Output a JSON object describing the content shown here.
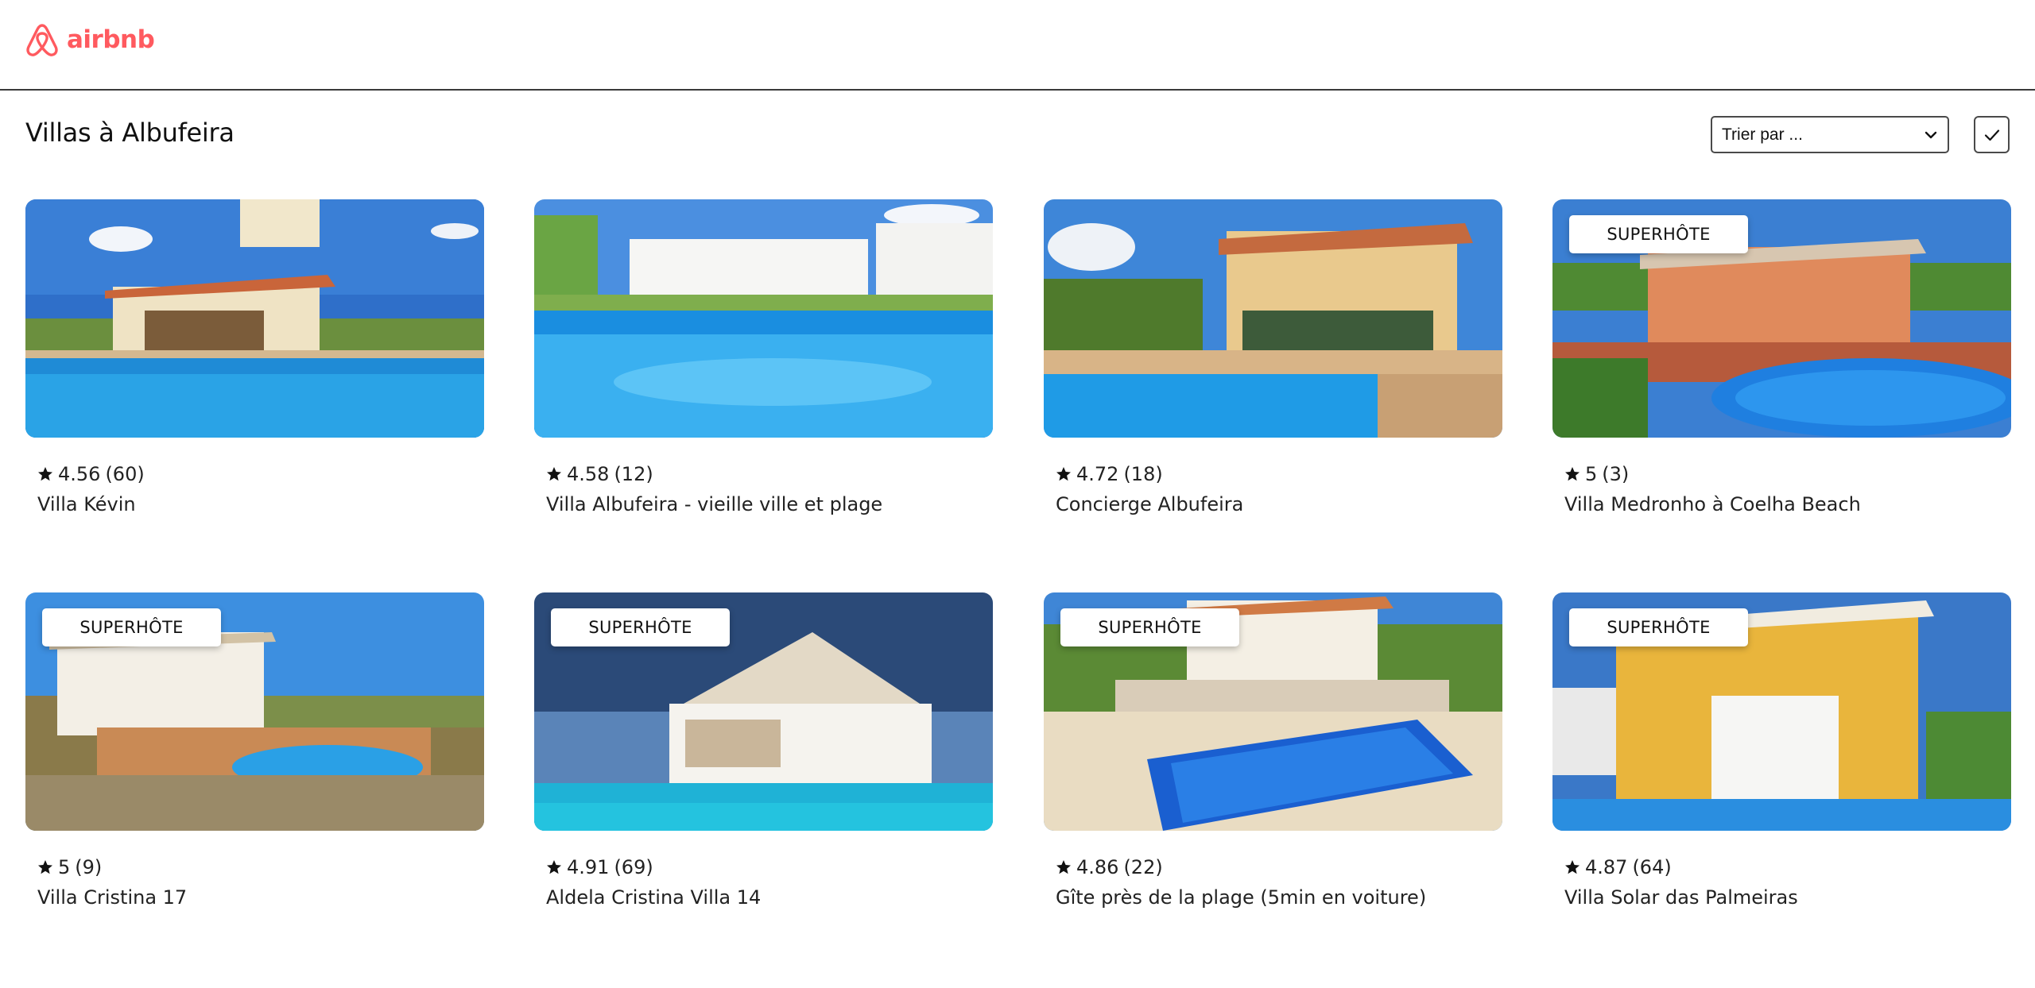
{
  "brand": {
    "name": "airbnb",
    "color": "#ff5a5f"
  },
  "page": {
    "title": "Villas à Albufeira"
  },
  "controls": {
    "sort_label": "Trier par ...",
    "confirm_icon": "check-icon"
  },
  "listings": [
    {
      "rating": "4.56",
      "reviews": "(60)",
      "name": "Villa Kévin",
      "badge": ""
    },
    {
      "rating": "4.58",
      "reviews": "(12)",
      "name": "Villa Albufeira - vieille ville et plage",
      "badge": ""
    },
    {
      "rating": "4.72",
      "reviews": "(18)",
      "name": "Concierge Albufeira",
      "badge": ""
    },
    {
      "rating": "5",
      "reviews": "(3)",
      "name": "Villa Medronho à Coelha Beach",
      "badge": "SUPERHÔTE"
    },
    {
      "rating": "5",
      "reviews": "(9)",
      "name": "Villa Cristina 17",
      "badge": "SUPERHÔTE"
    },
    {
      "rating": "4.91",
      "reviews": "(69)",
      "name": "Aldela Cristina Villa 14",
      "badge": "SUPERHÔTE"
    },
    {
      "rating": "4.86",
      "reviews": "(22)",
      "name": "Gîte près de la plage (5min en voiture)",
      "badge": "SUPERHÔTE"
    },
    {
      "rating": "4.87",
      "reviews": "(64)",
      "name": "Villa Solar das Palmeiras",
      "badge": "SUPERHÔTE"
    }
  ]
}
